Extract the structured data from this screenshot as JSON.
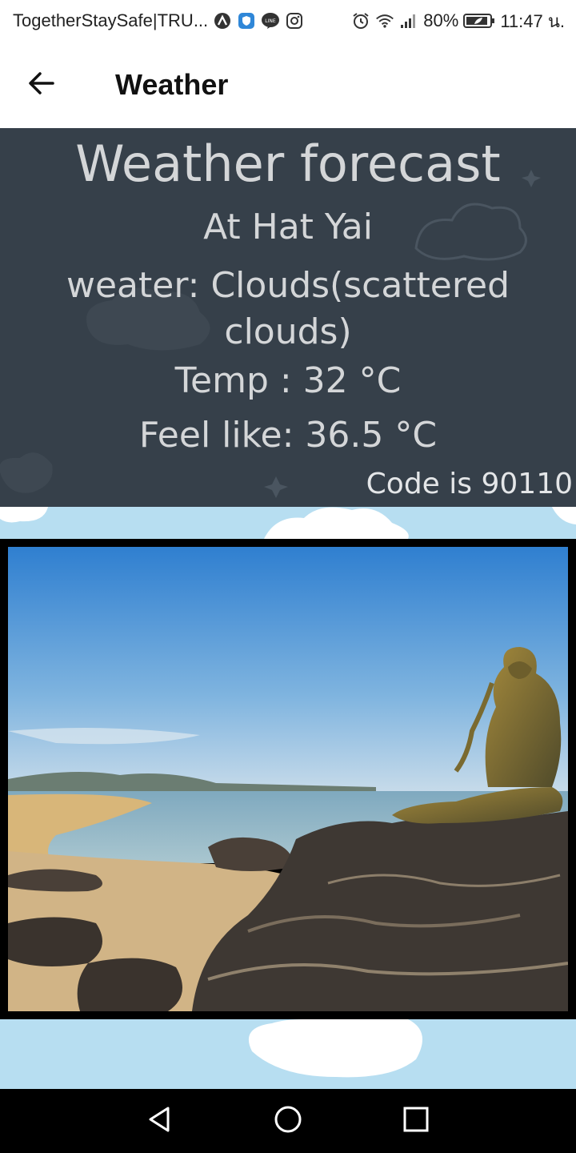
{
  "status_bar": {
    "app_notice": "TogetherStaySafe|TRU...",
    "battery": "80%",
    "time": "11:47 น.",
    "icons": [
      "app-a-icon",
      "shield-icon",
      "line-icon",
      "instagram-icon",
      "alarm-icon",
      "wifi-icon",
      "signal-icon",
      "battery-icon"
    ]
  },
  "app_bar": {
    "title": "Weather",
    "back_icon": "arrow-left-icon"
  },
  "forecast": {
    "heading": "Weather forecast",
    "location": "At Hat Yai",
    "weather": "weater: Clouds(scattered clouds)",
    "temp": "Temp : 32 °C",
    "feels_like": "Feel like: 36.5 °C",
    "code": "Code is 90110",
    "panel_color": "#36404a",
    "text_color": "#d4d6d8"
  },
  "image": {
    "subject": "beach with mermaid statue on rocks"
  },
  "sky_color": "#b7def1",
  "nav_bar": {
    "buttons": [
      "back-triangle-icon",
      "home-circle-icon",
      "recents-square-icon"
    ]
  }
}
